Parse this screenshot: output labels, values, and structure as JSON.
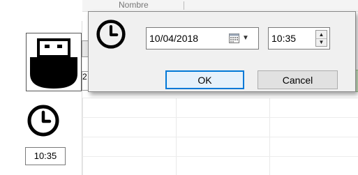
{
  "background": {
    "column_header_label": "Nombre",
    "clock_time": "10:35",
    "partial_cell_text": "2"
  },
  "dialog": {
    "date_value": "10/04/2018",
    "time_value": "10:35",
    "ok_label": "OK",
    "cancel_label": "Cancel"
  },
  "colors": {
    "accent": "#0078d7",
    "dialog_bg": "#f0f0f0"
  }
}
